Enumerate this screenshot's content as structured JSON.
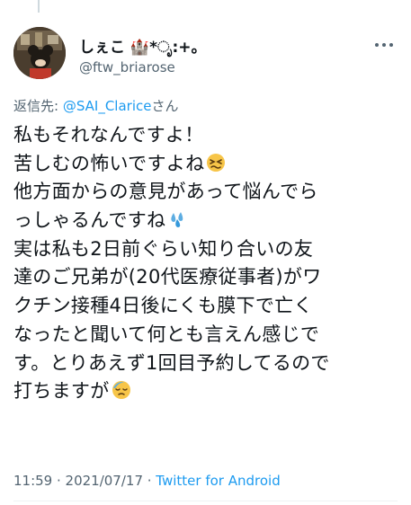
{
  "tweet": {
    "author": {
      "display_name": "しぇこ 🏰*ೃ:+。",
      "handle": "@ftw_briarose"
    },
    "reply_to": {
      "prefix": "返信先: ",
      "mention": "@SAI_Clarice",
      "suffix": "さん"
    },
    "text_lines": [
      "私もそれなんですよ！",
      "苦しむの怖いですよね",
      "他方面からの意見があって悩んでら",
      "っしゃるんですね",
      "実は私も2日前ぐらい知り合いの友",
      "達のご兄弟が(20代医療従事者)がワ",
      "クチン接種4日後にくも膜下で亡く",
      "なったと聞いて何とも言えん感じで",
      "す。とりあえず1回目予約してるので",
      "打ちますが"
    ],
    "emojis": [
      "persevering-face",
      "sweat-droplets",
      "downcast-face-with-sweat"
    ],
    "timestamp": "11:59 · 2021/07/17 · ",
    "source": "Twitter for Android"
  },
  "colors": {
    "text": "#0f1419",
    "secondary": "#536471",
    "link": "#1d9bf0"
  }
}
